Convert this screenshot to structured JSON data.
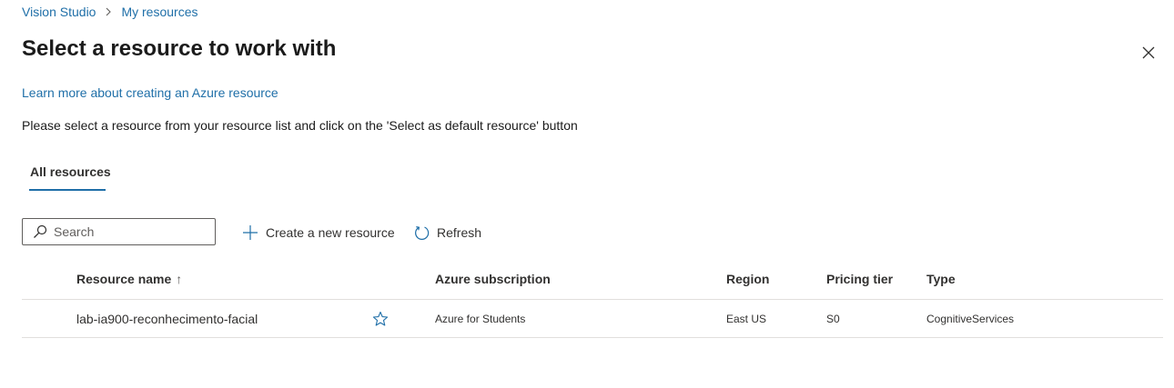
{
  "breadcrumb": {
    "items": [
      "Vision Studio",
      "My resources"
    ]
  },
  "page": {
    "title": "Select a resource to work with",
    "learn_more": "Learn more about creating an Azure resource",
    "instructions": "Please select a resource from your resource list and click on the 'Select as default resource' button"
  },
  "tabs": [
    {
      "label": "All resources",
      "selected": true
    }
  ],
  "toolbar": {
    "search_placeholder": "Search",
    "create_label": "Create a new resource",
    "refresh_label": "Refresh"
  },
  "table": {
    "columns": [
      "Resource name",
      "Azure subscription",
      "Region",
      "Pricing tier",
      "Type"
    ],
    "sort_indicator": "↑",
    "rows": [
      {
        "name": "lab-ia900-reconhecimento-facial",
        "subscription": "Azure for Students",
        "region": "East US",
        "tier": "S0",
        "type": "CognitiveServices",
        "favorite": false
      }
    ]
  },
  "icons": {
    "breadcrumb_separator": "chevron-right-icon",
    "close": "close-icon",
    "search": "search-icon",
    "create": "plus-icon",
    "refresh": "refresh-icon",
    "favorite": "star-icon",
    "sort": "sort-ascending-icon"
  },
  "colors": {
    "accent": "#1f6fa8",
    "text": "#1b1b1b",
    "divider": "#e1dfdd"
  }
}
